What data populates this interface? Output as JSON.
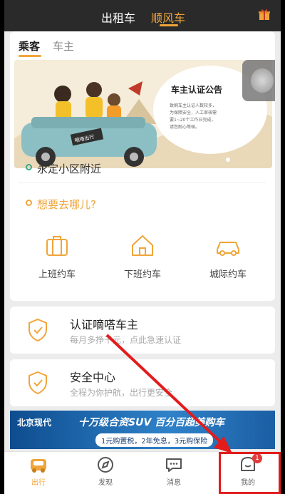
{
  "topbar": {
    "tabs": [
      {
        "label": "出租车"
      },
      {
        "label": "顺风车"
      }
    ],
    "active_index": 1
  },
  "subtabs": [
    {
      "label": "乘客"
    },
    {
      "label": "车主"
    }
  ],
  "banner": {
    "notice_title": "车主认证公告",
    "notice_body": "致刷车主认证人数较多，为保障安全，人工审核需要1~20个工作日完成，请您耐心等候。",
    "car_sign": "嘀嗒出行"
  },
  "location": {
    "current": "永定小区附近",
    "destination_placeholder": "想要去哪儿?"
  },
  "services": [
    {
      "label": "上班约车"
    },
    {
      "label": "下班约车"
    },
    {
      "label": "城际约车"
    }
  ],
  "cards": [
    {
      "title": "认证嘀嗒车主",
      "subtitle": "每月多挣千元，点此急速认证"
    },
    {
      "title": "安全中心",
      "subtitle": "全程为你护航，出行更安全"
    }
  ],
  "ad": {
    "brand": "北京现代",
    "headline": "十万级合资SUV 百分百超美购车",
    "offer": "1元购置税，2年免息，3元购保险"
  },
  "bottom_nav": {
    "items": [
      {
        "label": "出行"
      },
      {
        "label": "发现"
      },
      {
        "label": "消息"
      },
      {
        "label": "我的"
      }
    ],
    "active_index": 0,
    "mine_badge": "1"
  },
  "colors": {
    "accent": "#f0a53a",
    "topbar": "#2a2a2a",
    "highlight": "#e21c1c",
    "green": "#3aa88a"
  }
}
